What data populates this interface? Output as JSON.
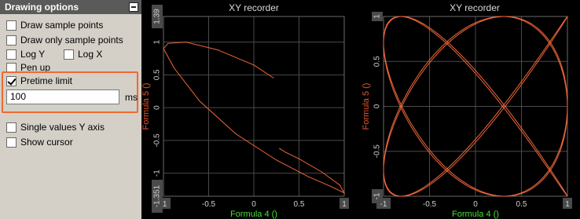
{
  "panel": {
    "title": "Drawing options",
    "draw_sample_points": "Draw sample points",
    "draw_only_sample_points": "Draw only sample points",
    "log_y": "Log Y",
    "log_x": "Log X",
    "pen_up": "Pen up",
    "pretime_limit": "Pretime limit",
    "pretime_value": "100",
    "pretime_unit": "ms",
    "single_values_y_axis": "Single values Y axis",
    "show_cursor": "Show cursor"
  },
  "colors": {
    "trace": "#f2663a",
    "y_label": "#e8522a",
    "x_label": "#4ddc3a",
    "highlight": "#ef6a30"
  },
  "chart_data": [
    {
      "type": "line",
      "title": "XY recorder",
      "xlabel": "Formula 4 ()",
      "ylabel": "Formula 5 ()",
      "xlim": [
        -1,
        1
      ],
      "ylim": [
        -1.351,
        1.39
      ],
      "x_ticks": [
        "-1",
        "-0.5",
        "0",
        "0.5",
        "1"
      ],
      "y_ticks": [
        "1.39",
        "1",
        "0.5",
        "0",
        "-0.5",
        "-1",
        "-1.351"
      ],
      "grid": true,
      "series": [
        {
          "points": [
            [
              0.22,
              0.45
            ],
            [
              0.0,
              0.65
            ],
            [
              -0.4,
              0.88
            ],
            [
              -0.75,
              1.0
            ],
            [
              -0.95,
              0.98
            ],
            [
              -1.0,
              0.9
            ],
            [
              -0.88,
              0.6
            ],
            [
              -0.6,
              0.1
            ],
            [
              -0.2,
              -0.4
            ],
            [
              0.25,
              -0.8
            ],
            [
              0.6,
              -1.05
            ],
            [
              0.85,
              -1.2
            ],
            [
              1.0,
              -1.3
            ],
            [
              0.95,
              -1.18
            ],
            [
              0.75,
              -0.98
            ],
            [
              0.5,
              -0.78
            ],
            [
              0.35,
              -0.68
            ],
            [
              0.28,
              -0.62
            ]
          ]
        }
      ]
    },
    {
      "type": "line",
      "title": "XY recorder",
      "xlabel": "Formula 4 ()",
      "ylabel": "Formula 5 ()",
      "xlim": [
        -1,
        1
      ],
      "ylim": [
        -1,
        1
      ],
      "x_ticks": [
        "-1",
        "-0.5",
        "0",
        "0.5",
        "1"
      ],
      "y_ticks": [
        "1",
        "0.5",
        "0",
        "-0.5",
        "-1"
      ],
      "grid": true,
      "series": [
        {
          "lissajous": {
            "fx": 4,
            "fy": 5,
            "phase": 0.3,
            "cycles": 1
          }
        }
      ]
    }
  ]
}
